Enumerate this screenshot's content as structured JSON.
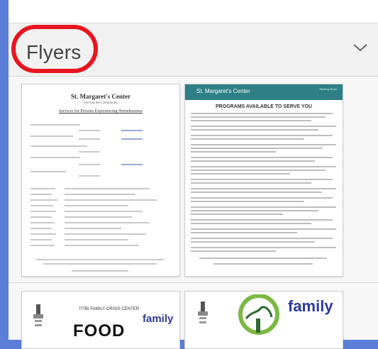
{
  "section": {
    "title": "Flyers",
    "expanded": true
  },
  "flyers": [
    {
      "heading": "St. Margaret's Center",
      "subheading": "Serving the Community",
      "doc_title": "Services for Persons Experiencing Homelessness"
    },
    {
      "org": "St. Margaret's Center",
      "tagline": "Serving Since",
      "doc_title": "PROGRAMS AVAILABLE TO SERVE YOU"
    },
    {
      "org": "TITBI FAMILY CRISIS CENTER",
      "headline": "FOOD",
      "brand": "family"
    },
    {
      "brand": "family"
    }
  ],
  "colors": {
    "accent_circle": "#e8141f",
    "frame": "#5b7fd8",
    "teal": "#2e7f86",
    "family_blue": "#2d3a9a",
    "family_green": "#6aa839"
  },
  "icons": {
    "collapse": "chevron-down-icon"
  }
}
